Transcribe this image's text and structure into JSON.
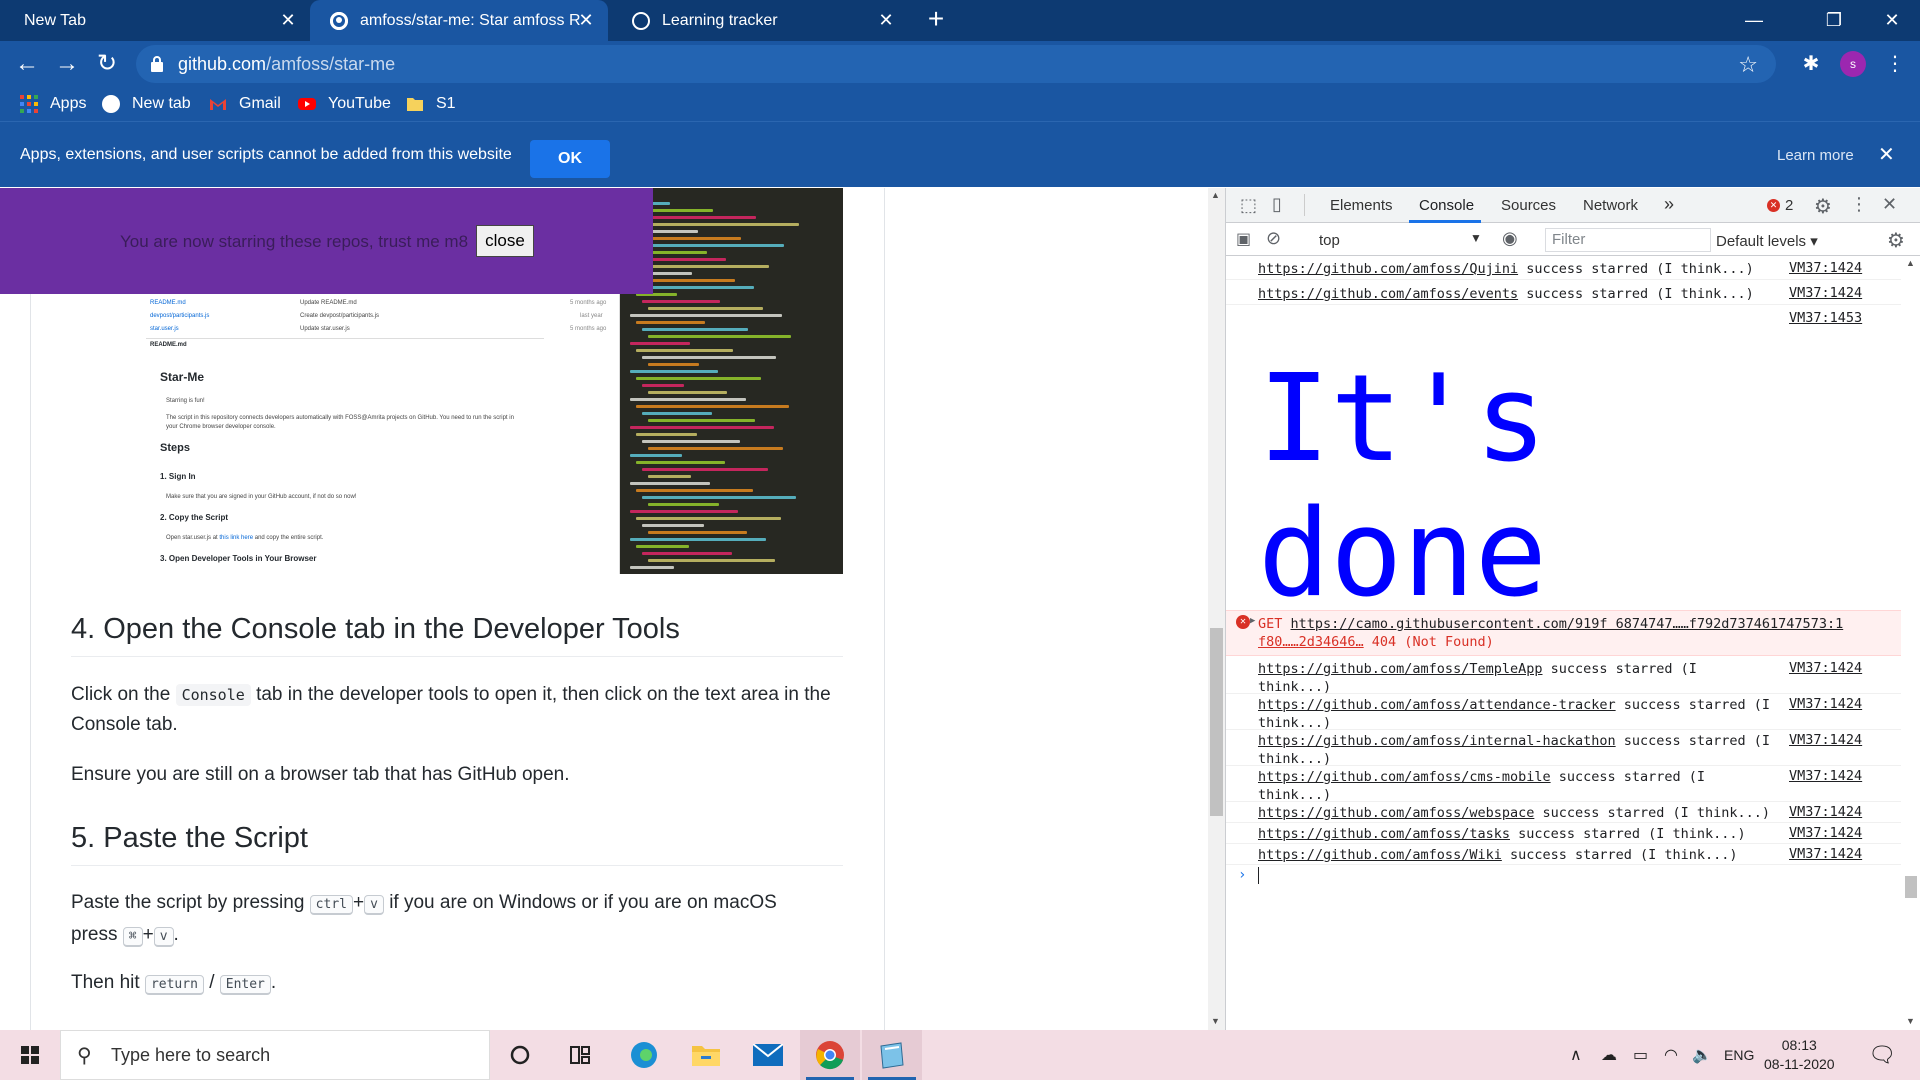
{
  "tabs": [
    {
      "title": "New Tab",
      "active": false
    },
    {
      "title": "amfoss/star-me: Star amfoss Rep",
      "active": true
    },
    {
      "title": "Learning tracker",
      "active": false
    }
  ],
  "address": {
    "host": "github.com",
    "path": "/amfoss/star-me"
  },
  "profile_initial": "s",
  "bookmarks": [
    "Apps",
    "New tab",
    "Gmail",
    "YouTube",
    "S1"
  ],
  "infobar": {
    "message": "Apps, extensions, and user scripts cannot be added from this website",
    "ok": "OK",
    "learn_more": "Learn more"
  },
  "popup": {
    "message": "You are now starring these repos, trust me m8",
    "close": "close"
  },
  "readme_shot": {
    "files": [
      {
        "name": "README.md",
        "msg": "Update README.md",
        "date": "5 months ago"
      },
      {
        "name": "devpost/participants.js",
        "msg": "Create devpost/participants.js",
        "date": "last year"
      },
      {
        "name": "star.user.js",
        "msg": "Update star.user.js",
        "date": "5 months ago"
      }
    ],
    "file_header": "README.md",
    "title": "Star-Me",
    "starring": "Starring is fun!",
    "intro": "The script in this repository connects developers automatically with FOSS@Amrita projects on GitHub. You need to run the script in your Chrome browser developer console.",
    "steps": "Steps",
    "step1": "1. Sign In",
    "step1_text": "Make sure that you are signed in your GitHub account, if not do so now!",
    "step2": "2. Copy the Script",
    "step2_text_a": "Open star.user.js at",
    "step2_link": "this link here",
    "step2_text_b": "and copy the entire script.",
    "step3": "3. Open Developer Tools in Your Browser"
  },
  "article": {
    "h4": "4. Open the Console tab in the Developer Tools",
    "p4a_1": "Click on the",
    "p4a_code": "Console",
    "p4a_2": "tab in the developer tools to open it, then click on the text area in the Console tab.",
    "p4b": "Ensure you are still on a browser tab that has GitHub open.",
    "h5": "5. Paste the Script",
    "p5a_1": "Paste the script by pressing",
    "p5a_k1": "ctrl",
    "p5a_plus": "+",
    "p5a_k2": "v",
    "p5a_2": "if you are on Windows or if you are on macOS",
    "p5a_3": "press",
    "p5a_k3": "⌘",
    "p5a_k4": "v",
    "p5b_1": "Then hit",
    "p5b_k1": "return",
    "p5b_sep": "/",
    "p5b_k2": "Enter",
    "p5b_end": "."
  },
  "devtools": {
    "tabs": [
      "Elements",
      "Console",
      "Sources",
      "Network",
      "»"
    ],
    "error_count": "2",
    "context": "top",
    "filter_placeholder": "Filter",
    "levels": "Default levels",
    "messages_top": [
      {
        "url": "https://github.com/amfoss/Qujini",
        "text": " success starred (I think...)",
        "src": "VM37:1424"
      },
      {
        "url": "https://github.com/amfoss/events",
        "text": " success starred (I think...)",
        "src": "VM37:1424"
      },
      {
        "url": "",
        "text": "",
        "src": "VM37:1453"
      }
    ],
    "big_text_line1": "It's",
    "big_text_line2": "done",
    "error": {
      "line1_prefix": "GET ",
      "line1_url": "https://camo.githubusercontent.com/919f 6874747……f792d7374617475​73:1",
      "line2_url": "f80……2d34646…",
      "line2_suffix": " 404 (Not Found)"
    },
    "messages_bottom": [
      {
        "url": "https://github.com/amfoss/TempleApp",
        "l1": " success starred (I",
        "l2": "think...)",
        "src": "VM37:1424"
      },
      {
        "url": "https://github.com/amfoss/attendance-tracker",
        "l1": " success starred (I",
        "l2": "think...)",
        "src": "VM37:1424"
      },
      {
        "url": "https://github.com/amfoss/internal-hackathon",
        "l1": " success starred (I",
        "l2": "think...)",
        "src": "VM37:1424"
      },
      {
        "url": "https://github.com/amfoss/cms-mobile",
        "l1": " success starred (I",
        "l2": "think...)",
        "src": "VM37:1424"
      },
      {
        "url": "https://github.com/amfoss/webspace",
        "l1": " success starred (I think...)",
        "l2": "",
        "src": "VM37:1424"
      },
      {
        "url": "https://github.com/amfoss/tasks",
        "l1": " success starred (I think...)",
        "l2": "",
        "src": "VM37:1424"
      },
      {
        "url": "https://github.com/amfoss/Wiki",
        "l1": " success starred (I think...)",
        "l2": "",
        "src": "VM37:1424"
      }
    ]
  },
  "taskbar": {
    "search_placeholder": "Type here to search",
    "lang": "ENG",
    "time": "08:13",
    "date": "08-11-2020"
  },
  "colors": {
    "tabstrip": "#0d3a72",
    "toolbar": "#1a56a2",
    "popup": "#6b2fa2",
    "console_big_text": "#0000ff",
    "error": "#d93025",
    "taskbar": "#f3dde4"
  }
}
